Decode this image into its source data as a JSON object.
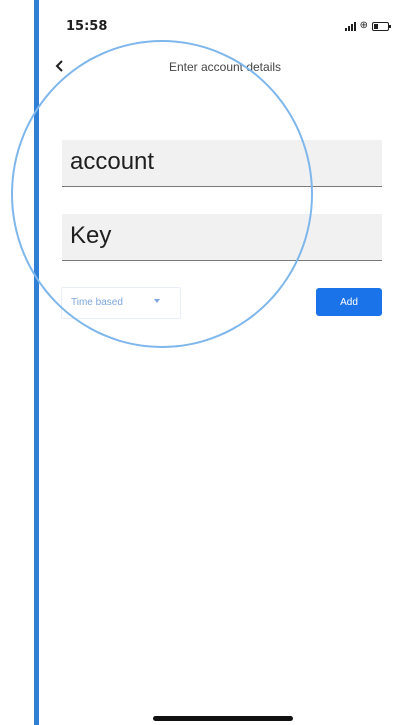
{
  "status_bar": {
    "time": "15:58"
  },
  "header": {
    "title": "Enter account details"
  },
  "form": {
    "account_value": "account",
    "key_value": "Key",
    "type_select": "Time based",
    "add_label": "Add"
  },
  "icons": {
    "back": "chevron-left-icon",
    "signal": "cellular-signal-icon",
    "link": "link-icon",
    "battery": "battery-icon",
    "dropdown": "caret-down-icon"
  },
  "colors": {
    "accent": "#1a73e8",
    "left_border": "#2f7fd6",
    "magnifier_ring": "#7fb7ec",
    "dropdown_text": "#7fa6dc",
    "field_background": "#f1f1f1"
  }
}
